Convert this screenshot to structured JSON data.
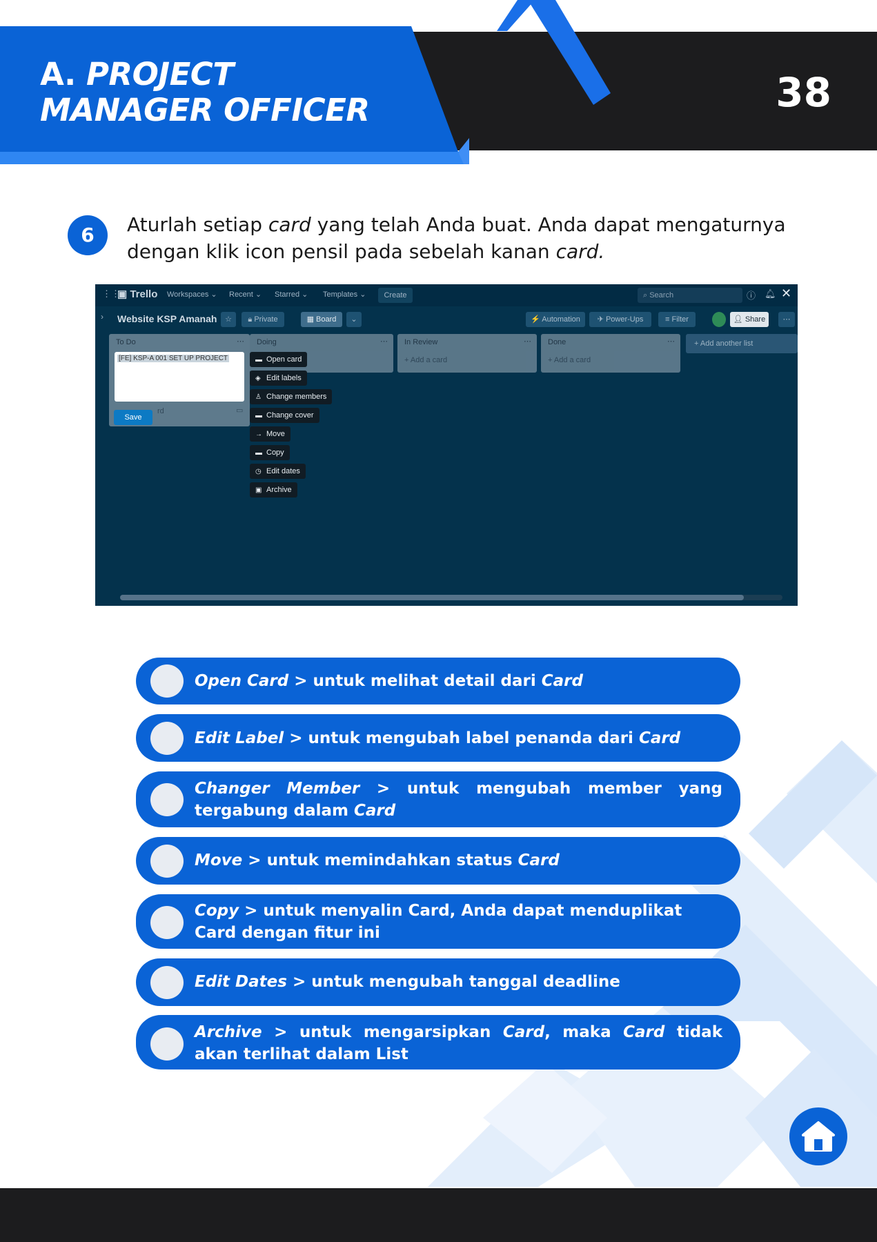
{
  "header": {
    "section_letter": "A.",
    "title_line1": "PROJECT",
    "title_line2": "MANAGER OFFICER",
    "page_number": "38",
    "colors": {
      "primary_blue": "#0a63d6",
      "dark": "#1c1c1e"
    }
  },
  "step": {
    "number": "6",
    "text_parts": [
      "Aturlah setiap ",
      "card",
      " yang telah Anda buat. Anda dapat mengaturnya dengan klik icon pensil pada sebelah kanan ",
      "card."
    ]
  },
  "screenshot": {
    "app_name": "Trello",
    "nav": [
      "Workspaces",
      "Recent",
      "Starred",
      "Templates"
    ],
    "create_label": "Create",
    "search_placeholder": "Search",
    "board_name": "Website KSP Amanah",
    "private_label": "Private",
    "board_label": "Board",
    "automation_label": "Automation",
    "powerups_label": "Power-Ups",
    "filter_label": "Filter",
    "share_label": "Share",
    "lists": [
      {
        "title": "To Do"
      },
      {
        "title": "Doing"
      },
      {
        "title": "In Review",
        "add": "+ Add a card"
      },
      {
        "title": "Done",
        "add": "+ Add a card"
      }
    ],
    "add_list_label": "+ Add another list",
    "editing_card_text": "[FE] KSP-A 001 SET UP PROJECT",
    "save_label": "Save",
    "menu": [
      {
        "label": "Open card",
        "icon": "card-icon"
      },
      {
        "label": "Edit labels",
        "icon": "label-icon"
      },
      {
        "label": "Change members",
        "icon": "person-icon"
      },
      {
        "label": "Change cover",
        "icon": "cover-icon"
      },
      {
        "label": "Move",
        "icon": "arrow-right-icon"
      },
      {
        "label": "Copy",
        "icon": "copy-icon"
      },
      {
        "label": "Edit dates",
        "icon": "clock-icon"
      },
      {
        "label": "Archive",
        "icon": "archive-icon"
      }
    ]
  },
  "items": [
    {
      "key": "Open Card",
      "rest": " > untuk melihat detail dari ",
      "tail_italic": "Card",
      "tail": ""
    },
    {
      "key": "Edit Label",
      "rest": " > untuk mengubah label penanda dari ",
      "tail_italic": "Card",
      "tail": ""
    },
    {
      "key": "Changer Member",
      "rest": " > untuk mengubah member yang tergabung dalam ",
      "tail_italic": "Card",
      "tail": ""
    },
    {
      "key": "Move",
      "rest": " > untuk memindahkan status ",
      "tail_italic": "Card",
      "tail": ""
    },
    {
      "key": "Copy",
      "rest": " > untuk menyalin Card, Anda dapat menduplikat Card dengan fitur ini",
      "tail_italic": "",
      "tail": ""
    },
    {
      "key": "Edit Dates",
      "rest": " > untuk mengubah tanggal deadline",
      "tail_italic": "",
      "tail": ""
    },
    {
      "key": "Archive",
      "rest": " > untuk mengarsipkan ",
      "tail_italic": "Card",
      "tail": ", maka ",
      "tail2_italic": "Card",
      "tail2": " tidak akan terlihat dalam List"
    }
  ]
}
